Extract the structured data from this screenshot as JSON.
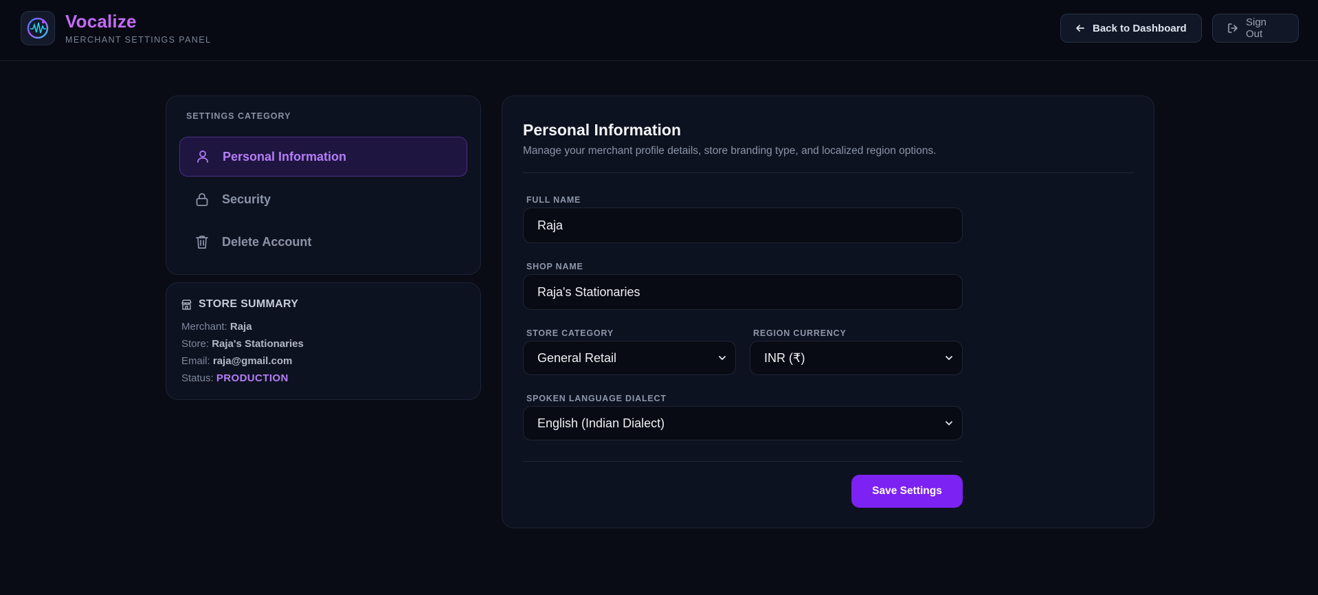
{
  "header": {
    "brand_title": "Vocalize",
    "brand_subtitle": "MERCHANT SETTINGS PANEL",
    "back_label": "Back to Dashboard",
    "signout_label": "Sign Out"
  },
  "sidebar": {
    "category_label": "SETTINGS CATEGORY",
    "items": [
      {
        "label": "Personal Information",
        "icon": "user-icon",
        "active": true
      },
      {
        "label": "Security",
        "icon": "lock-icon",
        "active": false
      },
      {
        "label": "Delete Account",
        "icon": "trash-icon",
        "active": false
      }
    ]
  },
  "summary": {
    "title": "STORE SUMMARY",
    "merchant_key": "Merchant:",
    "merchant_value": "Raja",
    "store_key": "Store:",
    "store_value": "Raja's Stationaries",
    "email_key": "Email:",
    "email_value": "raja@gmail.com",
    "status_key": "Status:",
    "status_value": "PRODUCTION"
  },
  "main": {
    "title": "Personal Information",
    "description": "Manage your merchant profile details, store branding type, and localized region options.",
    "full_name_label": "FULL NAME",
    "full_name_value": "Raja",
    "shop_name_label": "SHOP NAME",
    "shop_name_value": "Raja's Stationaries",
    "store_category_label": "STORE CATEGORY",
    "store_category_value": "General Retail",
    "region_currency_label": "REGION CURRENCY",
    "region_currency_value": "INR (₹)",
    "dialect_label": "SPOKEN LANGUAGE DIALECT",
    "dialect_value": "English (Indian Dialect)",
    "save_label": "Save Settings"
  },
  "colors": {
    "accent": "#7c22f2",
    "brand": "#c36bf5",
    "background": "#090c14"
  }
}
